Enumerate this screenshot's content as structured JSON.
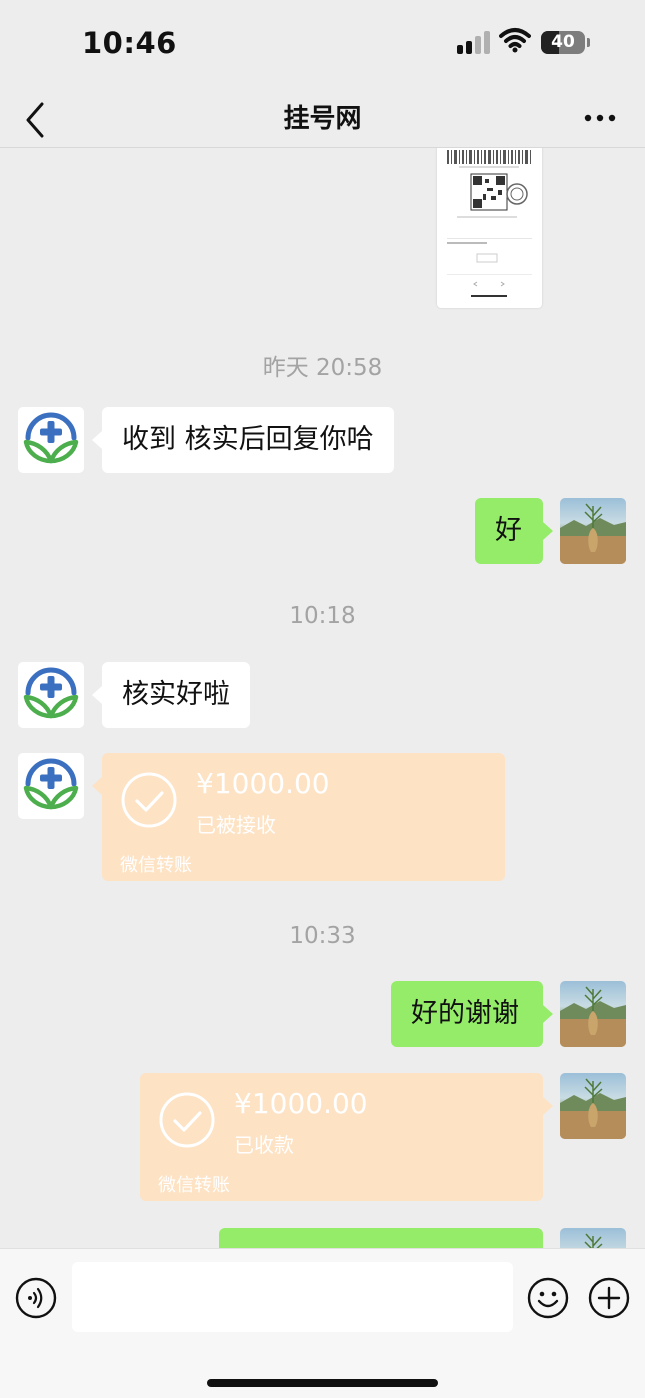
{
  "status_bar": {
    "time": "10:46",
    "battery": "40"
  },
  "nav": {
    "title": "挂号网"
  },
  "messages": {
    "ts1": "昨天 20:58",
    "m1": "收到  核实后回复你哈",
    "m2": "好",
    "ts2": "10:18",
    "m3": "核实好啦",
    "t1": {
      "amount": "¥1000.00",
      "status": "已被接收",
      "footer": "微信转账"
    },
    "ts3": "10:33",
    "m4": "好的谢谢",
    "t2": {
      "amount": "¥1000.00",
      "status": "已收款",
      "footer": "微信转账"
    }
  },
  "input": {
    "placeholder": ""
  },
  "icons": {
    "back": "chevron-left-icon",
    "more": "more-dots-icon",
    "voice": "voice-icon",
    "emoji": "emoji-icon",
    "plus": "plus-icon"
  },
  "colors": {
    "background": "#ededed",
    "bubble_out": "#95ec69",
    "bubble_in": "#ffffff",
    "transfer": "#fde2c4",
    "timestamp": "#a3a3a3",
    "hospital_blue": "#3b6fbf",
    "hospital_green": "#4cae4c"
  }
}
